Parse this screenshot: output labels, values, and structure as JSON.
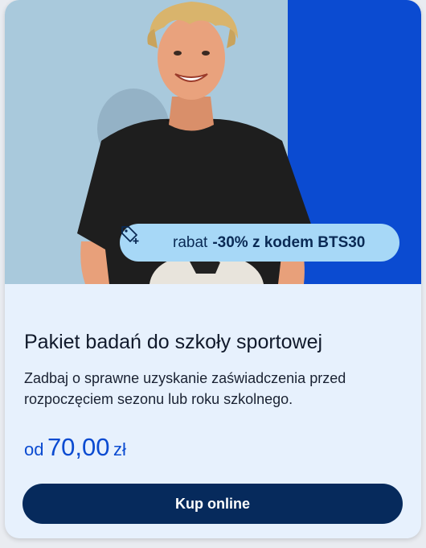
{
  "promo": {
    "icon": "tag-plus-icon",
    "prefix": "rabat",
    "bold": "-30% z kodem BTS30"
  },
  "card": {
    "title": "Pakiet badań do szkoły sportowej",
    "description": "Zadbaj o sprawne uzyskanie zaświadczenia przed rozpoczęciem sezonu lub roku szkolnego.",
    "price_prefix": "od",
    "price_value": "70,00",
    "price_unit": "zł",
    "button_label": "Kup online"
  },
  "colors": {
    "card_background": "#e7f1fd",
    "hero_left": "#a9c9dc",
    "hero_right": "#0b4bd1",
    "promo_pill": "#a7d8f7",
    "price": "#0b4bd1",
    "button": "#062a5c"
  }
}
